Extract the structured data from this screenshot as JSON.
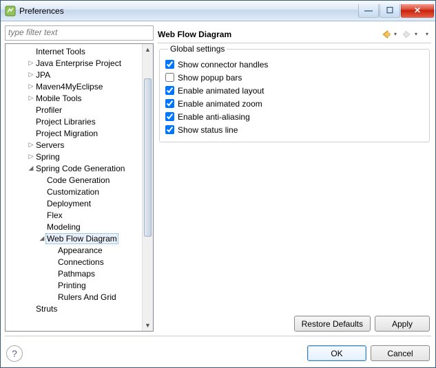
{
  "window": {
    "title": "Preferences"
  },
  "filter": {
    "placeholder": "type filter text"
  },
  "tree": [
    {
      "label": "Internet Tools",
      "indent": 2,
      "toggle": " "
    },
    {
      "label": "Java Enterprise Project",
      "indent": 2,
      "toggle": "▷"
    },
    {
      "label": "JPA",
      "indent": 2,
      "toggle": "▷"
    },
    {
      "label": "Maven4MyEclipse",
      "indent": 2,
      "toggle": "▷"
    },
    {
      "label": "Mobile Tools",
      "indent": 2,
      "toggle": "▷"
    },
    {
      "label": "Profiler",
      "indent": 2,
      "toggle": " "
    },
    {
      "label": "Project Libraries",
      "indent": 2,
      "toggle": " "
    },
    {
      "label": "Project Migration",
      "indent": 2,
      "toggle": " "
    },
    {
      "label": "Servers",
      "indent": 2,
      "toggle": "▷"
    },
    {
      "label": "Spring",
      "indent": 2,
      "toggle": "▷"
    },
    {
      "label": "Spring Code Generation",
      "indent": 2,
      "toggle": "◢"
    },
    {
      "label": "Code Generation",
      "indent": 3,
      "toggle": " "
    },
    {
      "label": "Customization",
      "indent": 3,
      "toggle": " "
    },
    {
      "label": "Deployment",
      "indent": 3,
      "toggle": " "
    },
    {
      "label": "Flex",
      "indent": 3,
      "toggle": " "
    },
    {
      "label": "Modeling",
      "indent": 3,
      "toggle": " "
    },
    {
      "label": "Web Flow Diagram",
      "indent": 3,
      "toggle": "◢",
      "selected": true
    },
    {
      "label": "Appearance",
      "indent": 4,
      "toggle": " "
    },
    {
      "label": "Connections",
      "indent": 4,
      "toggle": " "
    },
    {
      "label": "Pathmaps",
      "indent": 4,
      "toggle": " "
    },
    {
      "label": "Printing",
      "indent": 4,
      "toggle": " "
    },
    {
      "label": "Rulers And Grid",
      "indent": 4,
      "toggle": " "
    },
    {
      "label": "Struts",
      "indent": 2,
      "toggle": " "
    }
  ],
  "page": {
    "title": "Web Flow Diagram",
    "group": "Global settings",
    "checkboxes": [
      {
        "label": "Show connector handles",
        "checked": true
      },
      {
        "label": "Show popup bars",
        "checked": false
      },
      {
        "label": "Enable animated layout",
        "checked": true
      },
      {
        "label": "Enable animated zoom",
        "checked": true
      },
      {
        "label": "Enable anti-aliasing",
        "checked": true
      },
      {
        "label": "Show status line",
        "checked": true
      }
    ],
    "restore": "Restore Defaults",
    "apply": "Apply"
  },
  "footer": {
    "ok": "OK",
    "cancel": "Cancel"
  }
}
